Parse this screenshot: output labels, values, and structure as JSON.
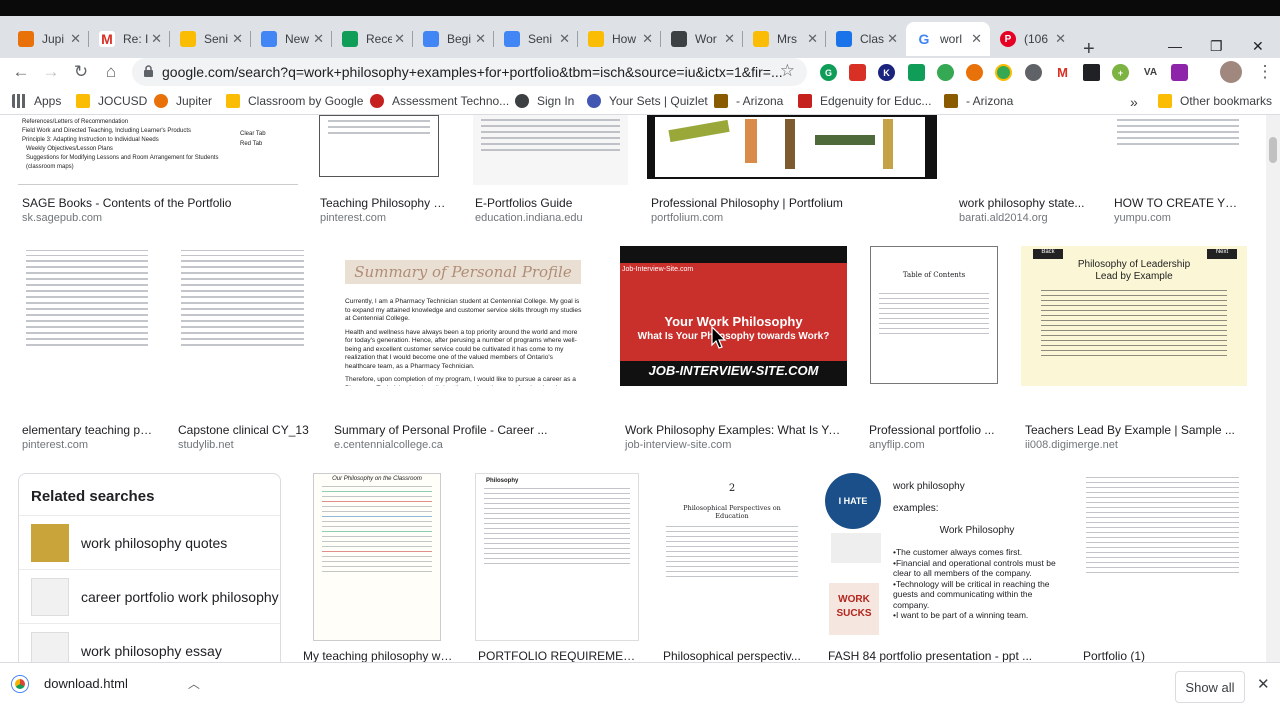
{
  "tabs": [
    {
      "title": "Jupi",
      "color": "#e8710a",
      "glyph": ""
    },
    {
      "title": "Re: I",
      "color": "#d93025",
      "glyph": "M"
    },
    {
      "title": "Seni",
      "color": "#fbbc04",
      "glyph": ""
    },
    {
      "title": "New",
      "color": "#4285f4",
      "glyph": ""
    },
    {
      "title": "Rece",
      "color": "#0f9d58",
      "glyph": ""
    },
    {
      "title": "Begi",
      "color": "#4285f4",
      "glyph": ""
    },
    {
      "title": "Seni",
      "color": "#4285f4",
      "glyph": ""
    },
    {
      "title": "How",
      "color": "#fbbc04",
      "glyph": ""
    },
    {
      "title": "Wor",
      "color": "#5f6368",
      "glyph": ""
    },
    {
      "title": "Mrs",
      "color": "#fbbc04",
      "glyph": ""
    },
    {
      "title": "Clas",
      "color": "#1a73e8",
      "glyph": ""
    },
    {
      "title": "worl",
      "color": "#4285f4",
      "glyph": "G"
    },
    {
      "title": "(106",
      "color": "#e60023",
      "glyph": "P"
    }
  ],
  "toolbar": {
    "url": "google.com/search?q=work+philosophy+examples+for+portfolio&tbm=isch&source=iu&ictx=1&fir=..."
  },
  "bookmarks": [
    {
      "label": "Apps",
      "color": "#5f6368"
    },
    {
      "label": "JOCUSD",
      "color": "#fbbc04"
    },
    {
      "label": "Jupiter",
      "color": "#e8710a"
    },
    {
      "label": "Classroom by Google",
      "color": "#fbbc04"
    },
    {
      "label": "Assessment Techno...",
      "color": "#c5221f"
    },
    {
      "label": "Sign In",
      "color": "#3c4043"
    },
    {
      "label": "Your Sets | Quizlet",
      "color": "#4257b2"
    },
    {
      "label": "- Arizona",
      "color": "#8a5a00"
    },
    {
      "label": "Edgenuity for Educ...",
      "color": "#c5221f"
    },
    {
      "label": "- Arizona",
      "color": "#8a5a00"
    }
  ],
  "other_bookmarks": "Other bookmarks",
  "results_row1": [
    {
      "caption": "SAGE Books - Contents of the Portfolio",
      "source": "sk.sagepub.com"
    },
    {
      "caption": "Teaching Philosophy St...",
      "source": "pinterest.com"
    },
    {
      "caption": "E-Portfolios Guide",
      "source": "education.indiana.edu"
    },
    {
      "caption": "Professional Philosophy | Portfolium",
      "source": "portfolium.com"
    },
    {
      "caption": "work philosophy state...",
      "source": "barati.ald2014.org"
    },
    {
      "caption": "HOW TO CREATE YOUR...",
      "source": "yumpu.com"
    }
  ],
  "results_row2": [
    {
      "caption": "elementary teaching ph...",
      "source": "pinterest.com"
    },
    {
      "caption": "Capstone clinical CY_13",
      "source": "studylib.net"
    },
    {
      "caption": "Summary of Personal Profile - Career ...",
      "source": "e.centennialcollege.ca"
    },
    {
      "caption": "Work Philosophy Examples: What Is You...",
      "source": "job-interview-site.com"
    },
    {
      "caption": "Professional portfolio ...",
      "source": "anyflip.com"
    },
    {
      "caption": "Teachers Lead By Example | Sample ...",
      "source": "ii008.digimerge.net"
    }
  ],
  "results_row3": [
    {
      "caption": "My teaching philosophy wr..."
    },
    {
      "caption": "PORTFOLIO REQUIREMENTS ..."
    },
    {
      "caption": "Philosophical perspectiv..."
    },
    {
      "caption": "FASH 84 portfolio presentation - ppt ..."
    },
    {
      "caption": "Portfolio (1)"
    }
  ],
  "thumb_text": {
    "sage_lines": [
      "References/Letters of Recommendation",
      "Field Work and Directed Teaching, Including Learner's Products",
      "Principle 3: Adapting Instruction to Individual Needs",
      "Weekly Objectives/Lesson Plans",
      "Suggestions for Modifying Lessons and Room Arrangement for Students",
      "(classroom maps)"
    ],
    "sage_side": [
      "Clear Tab",
      "Red Tab"
    ],
    "summary_title": "Summary of Personal Profile",
    "summary_p1": "Currently, I am a Pharmacy Technician student at Centennial College. My goal is to expand my attained knowledge and customer service skills through my studies at Centennial College.",
    "summary_p2": "Health and wellness have always been a top priority around the world and more for today's generation. Hence, after perusing a number of programs where well-being and excellent customer service could be cultivated it has come to my realization that I would become one of the valued members of Ontario's healthcare team, as a Pharmacy Technician.",
    "summary_p3": "Therefore, upon completion of my program, I would like to pursue a career as a Pharmacy Technician in a hospital setting and apply my professional and customer service experience, providing outstanding healthcare towards society.",
    "job_site": "Job-Interview-Site.com",
    "job_title": "Your Work Philosophy",
    "job_sub": "What Is Your Philosophy towards Work?",
    "job_footer": "JOB-INTERVIEW-SITE.COM",
    "toc": "Table of Contents",
    "lead_title": "Philosophy of Leadership",
    "lead_sub": "Lead by Example",
    "lead_back": "Back",
    "lead_next": "Next",
    "fash_title": "work philosophy",
    "fash_examples": "examples:",
    "fash_heading": "Work Philosophy",
    "fash_bullets": [
      "•The customer always comes first.",
      "•Financial and operational controls must be clear to all members of the company.",
      "•Technology will be critical in reaching the guests and communicating within the company.",
      "•I want to be part of a winning team."
    ],
    "fash_badge": "I HATE WORK",
    "fash_sucks": "WORK SUCKS",
    "philo_num": "2",
    "philo_title": "Philosophical Perspectives on Education",
    "portfolio_heading": "Philosophy",
    "mytp_heading": "Our Philosophy on the Classroom"
  },
  "related": {
    "title": "Related searches",
    "items": [
      {
        "label": "work philosophy quotes"
      },
      {
        "label": "career portfolio work philosophy"
      },
      {
        "label": "work philosophy essay"
      }
    ]
  },
  "downloads": {
    "file": "download.html",
    "show_all": "Show all"
  }
}
